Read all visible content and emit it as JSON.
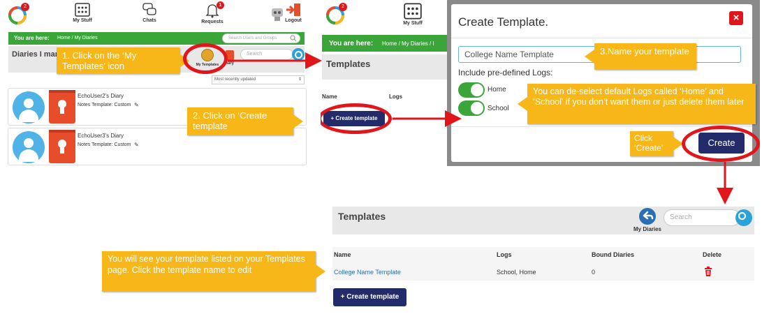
{
  "panel1": {
    "nav": {
      "my_stuff": "My Stuff",
      "chats": "Chats",
      "requests": "Requests",
      "logout": "Logout",
      "logo_badge": "2",
      "requests_badge": "1"
    },
    "breadcrumb": {
      "you_are_here": "You are here:",
      "path": "Home / My Diaries",
      "search_placeholder": "Search Users and Groups"
    },
    "header": {
      "title": "Diaries I mar",
      "my_templates_label": "My Templates",
      "diary_label": "Diary",
      "search_placeholder": "Search"
    },
    "sort": {
      "selected": "Most recently updated"
    },
    "cards": [
      {
        "title": "EchoUser2's Diary",
        "subtitle": "Notes Template: Custom"
      },
      {
        "title": "EchoUser3's Diary",
        "subtitle": "Notes Template: Custom"
      }
    ]
  },
  "panel2": {
    "my_stuff": "My Stuff",
    "logo_badge": "2",
    "you_are_here": "You are here:",
    "path": "Home / My Diaries / I",
    "title": "Templates",
    "col_name": "Name",
    "col_logs": "Logs",
    "create_button": "+ Create template"
  },
  "modal": {
    "title": "Create Template.",
    "close": "×",
    "name_value": "College Name Template",
    "include_label": "Include pre-defined Logs:",
    "log1": "Home",
    "log2": "School",
    "create_button": "Create"
  },
  "panel4": {
    "title": "Templates",
    "back_label": "My Diaries",
    "search_placeholder": "Search",
    "columns": [
      "Name",
      "Logs",
      "Bound Diaries",
      "Delete"
    ],
    "rows": [
      {
        "name": "College Name Template",
        "logs": "School, Home",
        "bound": "0"
      }
    ],
    "create_button": "+ Create template"
  },
  "callouts": {
    "c1": "1. Click on the  ‘My Templates’ icon",
    "c2": "2. Click on ‘Create template",
    "c3": "3.Name your template",
    "c4": "You can de-select default Logs called ‘Home’ and ‘School’ if you don’t want them or just delete them later",
    "c5": "Click ‘Create’",
    "c6": "You will see your template listed on your Templates page. Click the template name to edit"
  },
  "colors": {
    "green": "#3aa63a",
    "navy": "#232b6b",
    "callout": "#f7b718",
    "ring": "#e0161b",
    "link": "#2a6fb5",
    "diary": "#e84d2b"
  }
}
